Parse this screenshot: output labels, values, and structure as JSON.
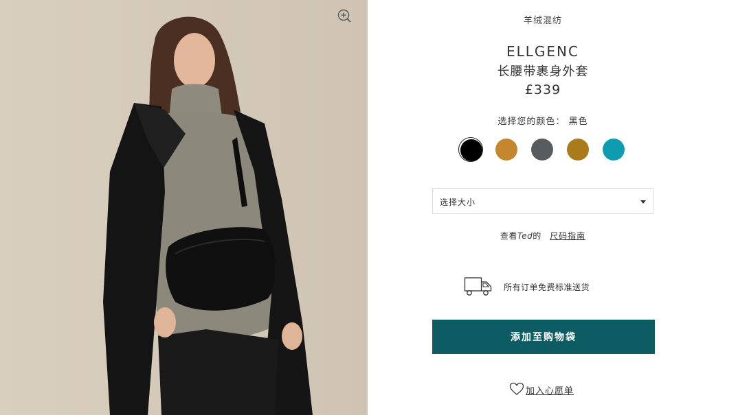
{
  "product": {
    "category": "羊绒混纺",
    "brand": "ELLGENC",
    "name": "长腰带裹身外套",
    "price": "£339"
  },
  "color_picker": {
    "label": "选择您的颜色：",
    "selected_name": "黑色",
    "swatches": [
      {
        "color": "#000000",
        "selected": true
      },
      {
        "color": "#c4862f",
        "selected": false
      },
      {
        "color": "#575b5e",
        "selected": false
      },
      {
        "color": "#a97b1d",
        "selected": false
      },
      {
        "color": "#0e9db0",
        "selected": false
      }
    ]
  },
  "size_select": {
    "label": "选择大小"
  },
  "size_guide": {
    "prefix": "查看",
    "brand": "Ted",
    "suffix": "的",
    "link": "尺码指南"
  },
  "delivery": {
    "icon": "truck-icon",
    "text": "所有订单免费标准送货"
  },
  "actions": {
    "add_to_bag": "添加至购物袋",
    "wishlist": "加入心愿单",
    "zoom_icon": "zoom-in-icon"
  },
  "colors": {
    "accent": "#0d5c63"
  }
}
